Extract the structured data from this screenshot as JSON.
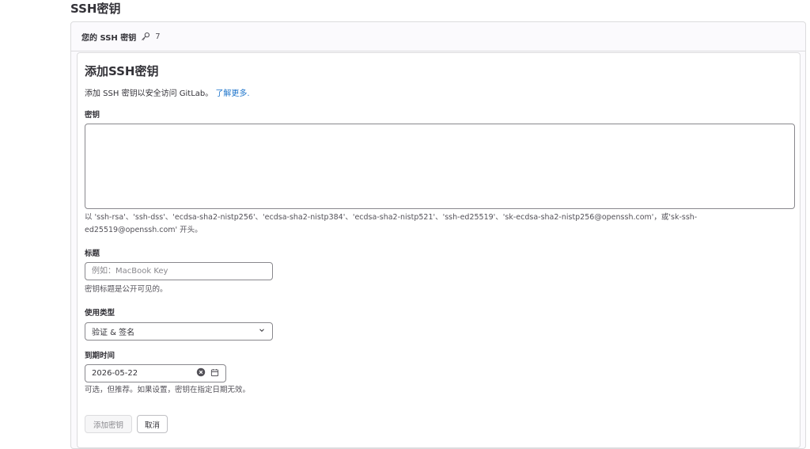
{
  "page": {
    "title": "SSH密钥"
  },
  "keys_card": {
    "header_label": "您的 SSH 密钥",
    "count": "7",
    "icon": "key-icon"
  },
  "form": {
    "title": "添加SSH密钥",
    "description": "添加 SSH 密钥以安全访问 GitLab。",
    "learn_more": "了解更多.",
    "key_label": "密钥",
    "key_value": "",
    "key_help_line1": "以 'ssh-rsa'、'ssh-dss'、'ecdsa-sha2-nistp256'、'ecdsa-sha2-nistp384'、'ecdsa-sha2-nistp521'、'ssh-ed25519'、'sk-ecdsa-sha2-nistp256@openssh.com'，或'sk-ssh-",
    "key_help_line2": "ed25519@openssh.com' 开头。",
    "title_label": "标题",
    "title_placeholder": "例如：MacBook Key",
    "title_help": "密钥标题是公开可见的。",
    "usage_label": "使用类型",
    "usage_value": "验证 & 签名",
    "expiry_label": "到期时间",
    "expiry_value": "2026-05-22",
    "expiry_help": "可选，但推荐。如果设置，密钥在指定日期无效。",
    "add_button": "添加密钥",
    "cancel_button": "取消"
  },
  "colors": {
    "link": "#1f75cb",
    "text": "#333238",
    "border": "#dcdcde"
  }
}
